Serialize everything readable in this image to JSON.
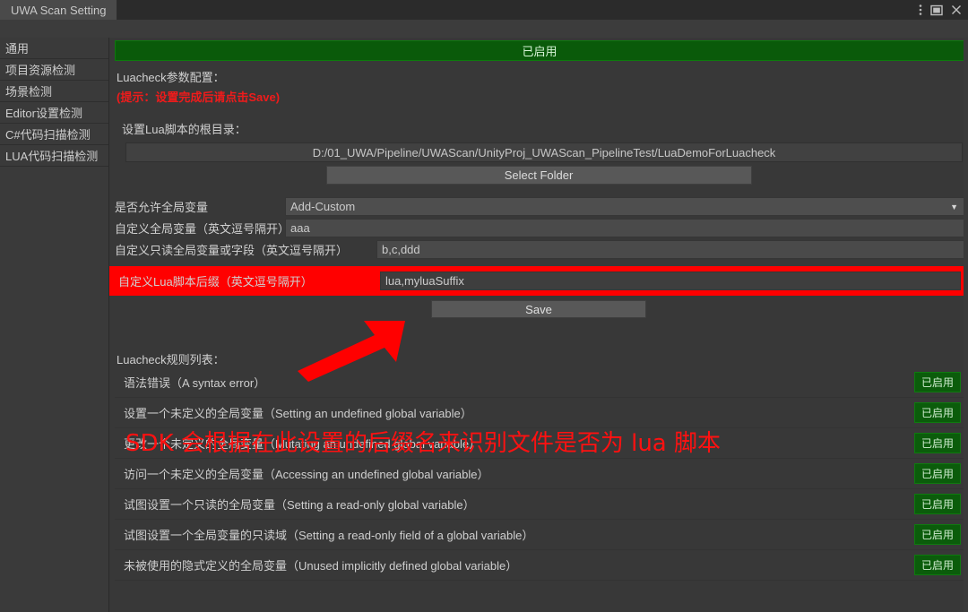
{
  "window": {
    "tab_title": "UWA Scan Setting",
    "menu_icon": "kebab-menu-icon",
    "maximize_icon": "maximize-icon",
    "close_icon": "close-icon"
  },
  "sidebar": {
    "items": [
      {
        "label": "通用"
      },
      {
        "label": "项目资源检测"
      },
      {
        "label": "场景检测"
      },
      {
        "label": "Editor设置检测"
      },
      {
        "label": "C#代码扫描检测"
      },
      {
        "label": "LUA代码扫描检测"
      }
    ]
  },
  "main": {
    "status_banner": "已启用",
    "section_title": "Luacheck参数配置：",
    "hint": "(提示：设置完成后请点击Save)",
    "root_dir_label": "设置Lua脚本的根目录：",
    "root_dir_path": "D:/01_UWA/Pipeline/UWAScan/UnityProj_UWAScan_PipelineTest/LuaDemoForLuacheck",
    "select_folder_label": "Select Folder",
    "save_label": "Save",
    "rules_title": "Luacheck规则列表：",
    "fields": [
      {
        "label": "是否允许全局变量",
        "value": "Add-Custom",
        "type": "dropdown",
        "name": "allow-global-variable-dropdown"
      },
      {
        "label": "自定义全局变量（英文逗号隔开）",
        "value": "aaa",
        "type": "text",
        "name": "custom-global-variable-input"
      },
      {
        "label": "自定义只读全局变量或字段（英文逗号隔开）",
        "value": "b,c,ddd",
        "type": "text",
        "name": "custom-readonly-global-input"
      }
    ],
    "highlighted_field": {
      "label": "自定义Lua脚本后缀（英文逗号隔开）",
      "value": "lua,myluaSuffix",
      "name": "custom-lua-suffix-input"
    },
    "rules": [
      {
        "label": "语法错误（A syntax error）",
        "status": "已启用"
      },
      {
        "label": "设置一个未定义的全局变量（Setting an undefined global variable）",
        "status": "已启用"
      },
      {
        "label": "更改一个未定义的全局变量（Mutating an undefined global variable）",
        "status": "已启用"
      },
      {
        "label": "访问一个未定义的全局变量（Accessing an undefined global variable）",
        "status": "已启用"
      },
      {
        "label": "试图设置一个只读的全局变量（Setting a read-only global variable）",
        "status": "已启用"
      },
      {
        "label": "试图设置一个全局变量的只读域（Setting a read-only field of a global variable）",
        "status": "已启用"
      },
      {
        "label": "未被使用的隐式定义的全局变量（Unused implicitly defined global variable）",
        "status": "已启用"
      }
    ]
  },
  "annotations": {
    "note_text": "SDK 会根据在此设置的后缀名来识别文件是否为 lua 脚本",
    "highlight_color": "#ff0000",
    "arrow_name": "pointer-arrow"
  },
  "colors": {
    "accent_red": "#ff0000",
    "enabled_green": "#0b5c0b",
    "background": "#383838"
  }
}
